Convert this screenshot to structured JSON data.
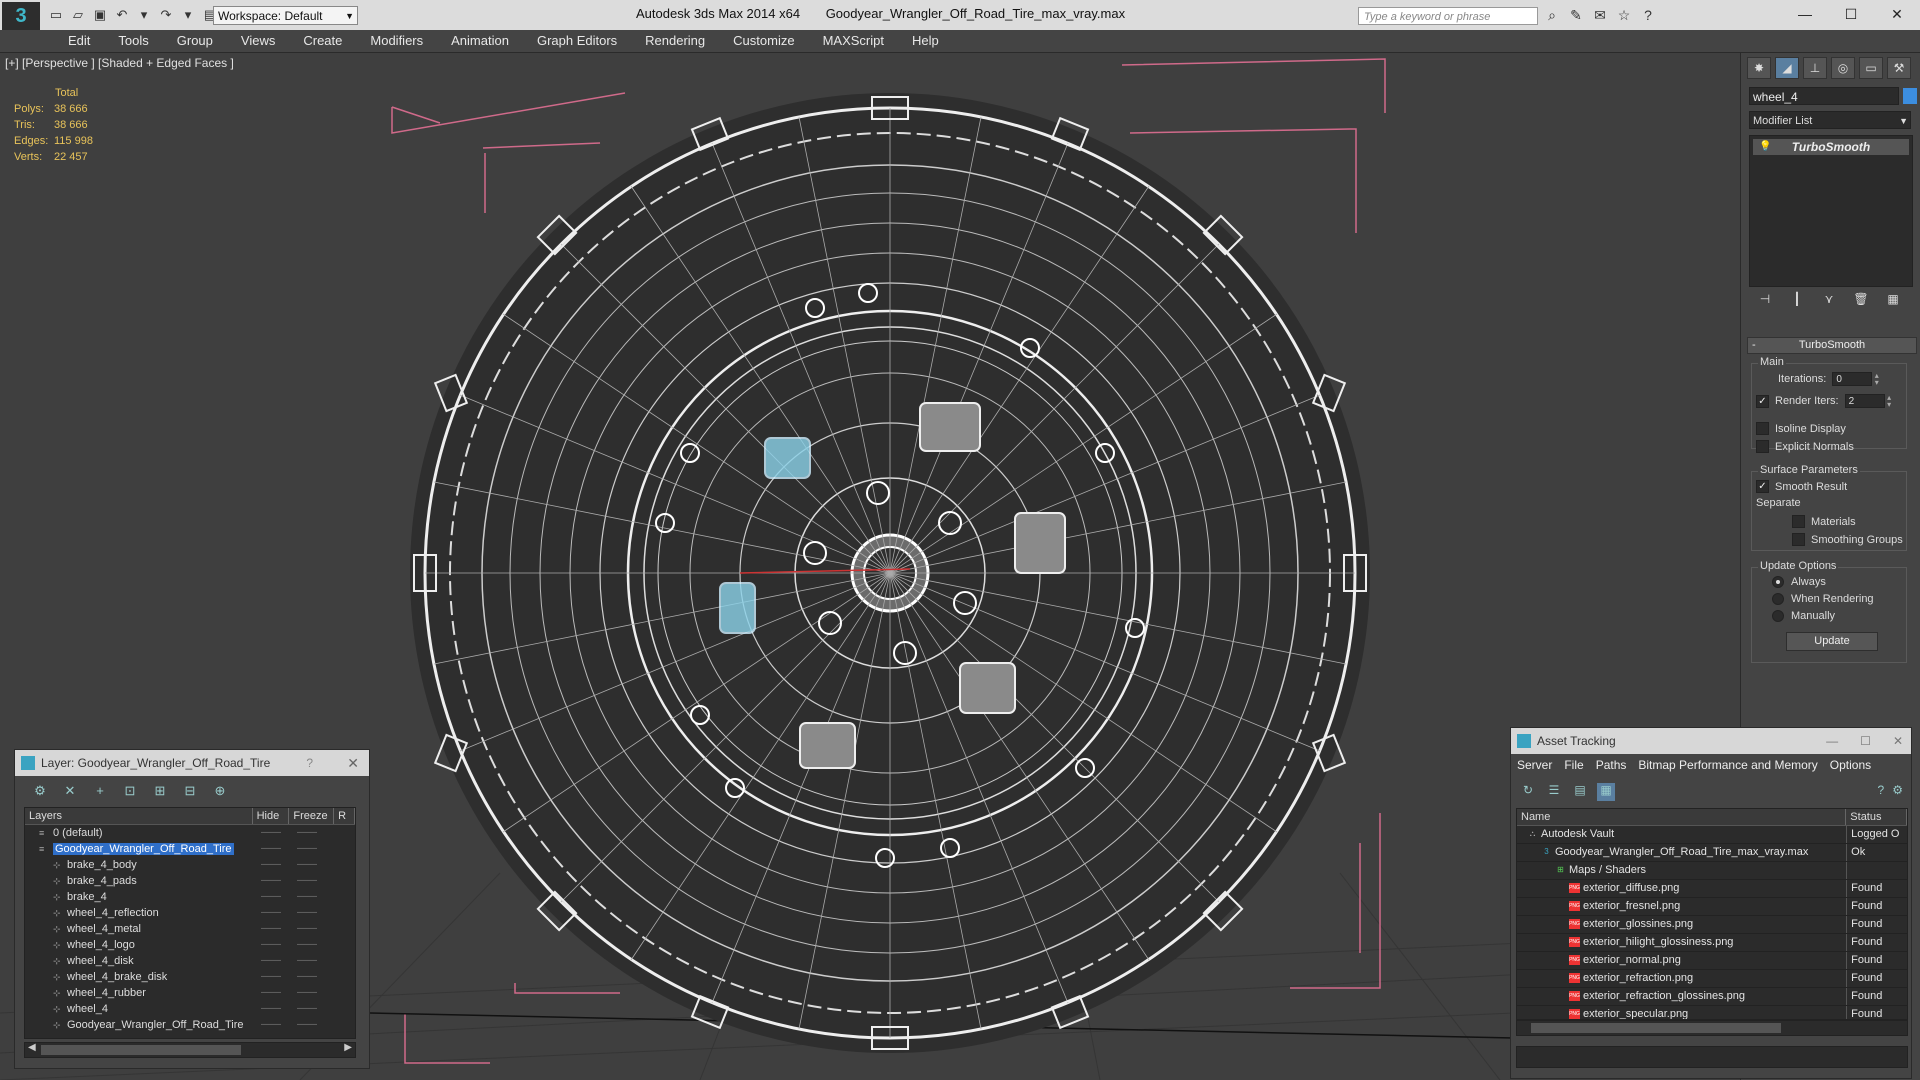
{
  "titlebar": {
    "app_title": "Autodesk 3ds Max  2014 x64",
    "file_title": "Goodyear_Wrangler_Off_Road_Tire_max_vray.max",
    "workspace": "Workspace: Default",
    "search_placeholder": "Type a keyword or phrase"
  },
  "menu": [
    "Edit",
    "Tools",
    "Group",
    "Views",
    "Create",
    "Modifiers",
    "Animation",
    "Graph Editors",
    "Rendering",
    "Customize",
    "MAXScript",
    "Help"
  ],
  "viewport": {
    "label": "[+] [Perspective ] [Shaded + Edged Faces ]",
    "stats": {
      "header": "Total",
      "polys_label": "Polys:",
      "polys": "38 666",
      "tris_label": "Tris:",
      "tris": "38 666",
      "edges_label": "Edges:",
      "edges": "115 998",
      "verts_label": "Verts:",
      "verts": "22 457"
    }
  },
  "command_panel": {
    "object_name": "wheel_4",
    "object_color": "#3c8ee0",
    "modifier_list": "Modifier List",
    "stack": [
      "TurboSmooth"
    ],
    "rollout_title": "TurboSmooth",
    "main_group": "Main",
    "iterations_label": "Iterations:",
    "iterations": "0",
    "render_iters_label": "Render Iters:",
    "render_iters": "2",
    "render_iters_checked": true,
    "isoline_label": "Isoline Display",
    "explicit_label": "Explicit Normals",
    "surface_group": "Surface Parameters",
    "smooth_result_label": "Smooth Result",
    "separate_label": "Separate",
    "materials_label": "Materials",
    "smoothing_groups_label": "Smoothing Groups",
    "update_group": "Update Options",
    "always_label": "Always",
    "when_rendering_label": "When Rendering",
    "manually_label": "Manually",
    "update_button": "Update"
  },
  "layer_panel": {
    "title": "Layer: Goodyear_Wrangler_Off_Road_Tire",
    "help": "?",
    "columns": [
      "Layers",
      "Hide",
      "Freeze",
      "R"
    ],
    "rows": [
      {
        "name": "0 (default)",
        "indent": 1,
        "selected": false
      },
      {
        "name": "Goodyear_Wrangler_Off_Road_Tire",
        "indent": 1,
        "selected": true
      },
      {
        "name": "brake_4_body",
        "indent": 2,
        "selected": false
      },
      {
        "name": "brake_4_pads",
        "indent": 2,
        "selected": false
      },
      {
        "name": "brake_4",
        "indent": 2,
        "selected": false
      },
      {
        "name": "wheel_4_reflection",
        "indent": 2,
        "selected": false
      },
      {
        "name": "wheel_4_metal",
        "indent": 2,
        "selected": false
      },
      {
        "name": "wheel_4_logo",
        "indent": 2,
        "selected": false
      },
      {
        "name": "wheel_4_disk",
        "indent": 2,
        "selected": false
      },
      {
        "name": "wheel_4_brake_disk",
        "indent": 2,
        "selected": false
      },
      {
        "name": "wheel_4_rubber",
        "indent": 2,
        "selected": false
      },
      {
        "name": "wheel_4",
        "indent": 2,
        "selected": false
      },
      {
        "name": "Goodyear_Wrangler_Off_Road_Tire",
        "indent": 2,
        "selected": false
      }
    ]
  },
  "asset_panel": {
    "title": "Asset Tracking",
    "menu": [
      "Server",
      "File",
      "Paths",
      "Bitmap Performance and Memory",
      "Options"
    ],
    "columns": [
      "Name",
      "Status"
    ],
    "rows": [
      {
        "name": "Autodesk Vault",
        "status": "Logged O",
        "level": 1,
        "icon": "vault"
      },
      {
        "name": "Goodyear_Wrangler_Off_Road_Tire_max_vray.max",
        "status": "Ok",
        "level": 2,
        "icon": "max"
      },
      {
        "name": "Maps / Shaders",
        "status": "",
        "level": 3,
        "icon": "maps"
      },
      {
        "name": "exterior_diffuse.png",
        "status": "Found",
        "level": 4,
        "icon": "png"
      },
      {
        "name": "exterior_fresnel.png",
        "status": "Found",
        "level": 4,
        "icon": "png"
      },
      {
        "name": "exterior_glossines.png",
        "status": "Found",
        "level": 4,
        "icon": "png"
      },
      {
        "name": "exterior_hilight_glossiness.png",
        "status": "Found",
        "level": 4,
        "icon": "png"
      },
      {
        "name": "exterior_normal.png",
        "status": "Found",
        "level": 4,
        "icon": "png"
      },
      {
        "name": "exterior_refraction.png",
        "status": "Found",
        "level": 4,
        "icon": "png"
      },
      {
        "name": "exterior_refraction_glossines.png",
        "status": "Found",
        "level": 4,
        "icon": "png"
      },
      {
        "name": "exterior_specular.png",
        "status": "Found",
        "level": 4,
        "icon": "png"
      }
    ]
  }
}
